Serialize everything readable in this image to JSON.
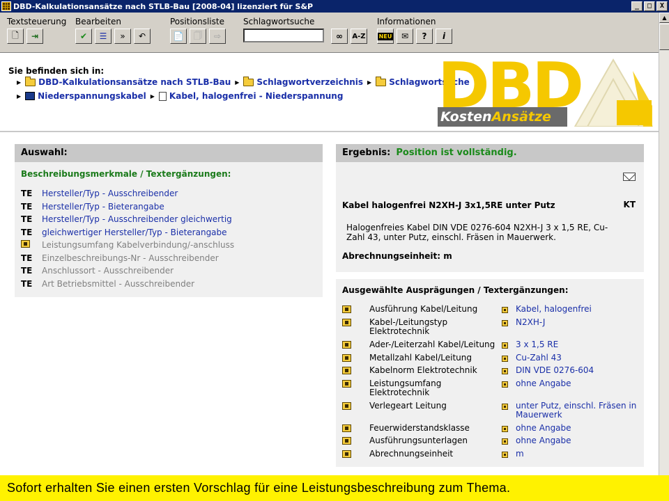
{
  "window": {
    "title": "DBD-Kalkulationsansätze nach STLB-Bau [2008-04] lizenziert für S&P",
    "min": "_",
    "max": "□",
    "close": "X"
  },
  "toolbar": {
    "groups": {
      "textsteuerung": "Textsteuerung",
      "bearbeiten": "Bearbeiten",
      "positionsliste": "Positionsliste",
      "schlagwortsuche": "Schlagwortsuche",
      "informationen": "Informationen"
    },
    "search_value": "",
    "az_label": "A-Z",
    "neu_label": "NEU"
  },
  "breadcrumb": {
    "title": "Sie befinden sich in:",
    "line1": [
      "DBD-Kalkulationsansätze nach STLB-Bau",
      "Schlagwortverzeichnis",
      "Schlagwortsuche"
    ],
    "line2": [
      "Niederspannungskabel",
      "Kabel, halogenfrei - Niederspannung"
    ]
  },
  "logo": {
    "big": "DBD",
    "sub_a": "Kosten",
    "sub_b": "Ansätze"
  },
  "auswahl": {
    "title": "Auswahl:",
    "subtitle": "Beschreibungsmerkmale / Textergänzungen:",
    "items": [
      {
        "marker": "TE",
        "text": "Hersteller/Typ - Ausschreibender",
        "active": true
      },
      {
        "marker": "TE",
        "text": "Hersteller/Typ - Bieterangabe",
        "active": true
      },
      {
        "marker": "TE",
        "text": "Hersteller/Typ - Ausschreibender gleichwertig",
        "active": true
      },
      {
        "marker": "TE",
        "text": "gleichwertiger Hersteller/Typ - Bieterangabe",
        "active": true
      },
      {
        "marker": "",
        "text": "Leistungsumfang Kabelverbindung/-anschluss",
        "active": false
      },
      {
        "marker": "TE",
        "text": "Einzelbeschreibungs-Nr - Ausschreibender",
        "active": false
      },
      {
        "marker": "TE",
        "text": "Anschlussort - Ausschreibender",
        "active": false
      },
      {
        "marker": "TE",
        "text": "Art Betriebsmittel - Ausschreibender",
        "active": false
      }
    ]
  },
  "ergebnis": {
    "title": "Ergebnis:",
    "status": "Position ist vollständig.",
    "position_title": "Kabel halogenfrei N2XH-J 3x1,5RE unter Putz",
    "kt": "KT",
    "position_text": "Halogenfreies Kabel DIN VDE 0276-604 N2XH-J 3 x 1,5 RE, Cu-Zahl 43, unter Putz, einschl. Fräsen in Mauerwerk.",
    "abrechnung": "Abrechnungseinheit: m"
  },
  "auspraegungen": {
    "title": "Ausgewählte Ausprägungen / Textergänzungen:",
    "rows": [
      {
        "label": "Ausführung Kabel/Leitung",
        "value": "Kabel, halogenfrei"
      },
      {
        "label": "Kabel-/Leitungstyp Elektrotechnik",
        "value": "N2XH-J"
      },
      {
        "label": "Ader-/Leiterzahl Kabel/Leitung",
        "value": "3 x 1,5 RE"
      },
      {
        "label": "Metallzahl Kabel/Leitung",
        "value": "Cu-Zahl 43"
      },
      {
        "label": "Kabelnorm Elektrotechnik",
        "value": "DIN VDE 0276-604"
      },
      {
        "label": "Leistungsumfang Elektrotechnik",
        "value": "ohne Angabe"
      },
      {
        "label": "Verlegeart Leitung",
        "value": "unter Putz, einschl. Fräsen in Mauerwerk"
      },
      {
        "label": "Feuerwiderstandsklasse",
        "value": "ohne Angabe"
      },
      {
        "label": "Ausführungsunterlagen",
        "value": "ohne Angabe"
      },
      {
        "label": "Abrechnungseinheit",
        "value": "m"
      }
    ]
  },
  "banner": {
    "text": "Sofort erhalten Sie einen ersten Vorschlag für eine Leistungsbeschreibung zum Thema."
  }
}
